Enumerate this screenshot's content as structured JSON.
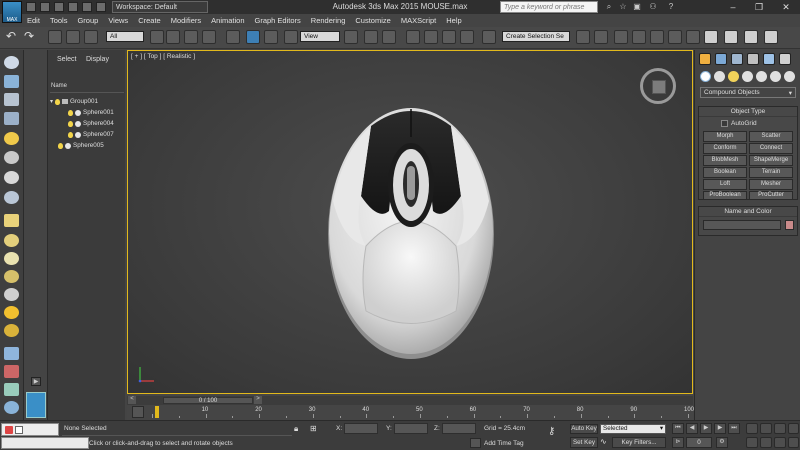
{
  "app": {
    "logo_text": "MAX",
    "workspace": "Workspace: Default",
    "window_title": "Autodesk 3ds Max  2015     MOUSE.max",
    "search_placeholder": "Type a keyword or phrase"
  },
  "menu": [
    "Edit",
    "Tools",
    "Group",
    "Views",
    "Create",
    "Modifiers",
    "Animation",
    "Graph Editors",
    "Rendering",
    "Customize",
    "MAXScript",
    "Help"
  ],
  "toolbar": {
    "filter_select": "All",
    "coord_system": "View",
    "selection_set": "Create Selection Se"
  },
  "explorer": {
    "tab_select": "Select",
    "tab_display": "Display",
    "column_name": "Name",
    "items": [
      {
        "label": "Group001",
        "depth": 0,
        "kind": "group"
      },
      {
        "label": "Sphere001",
        "depth": 1,
        "kind": "sphere"
      },
      {
        "label": "Sphere004",
        "depth": 1,
        "kind": "sphere"
      },
      {
        "label": "Sphere007",
        "depth": 1,
        "kind": "sphere"
      },
      {
        "label": "Sphere005",
        "depth": 0,
        "kind": "sphere"
      }
    ]
  },
  "viewport": {
    "label": "[ + ] [ Top ] [ Realistic ]",
    "border_color": "#e2b91c",
    "viewcube_face": "TOP"
  },
  "command_panel": {
    "category_dropdown": "Compound Objects",
    "object_type_title": "Object Type",
    "autogrid_label": "AutoGrid",
    "buttons": [
      "Morph",
      "Scatter",
      "Conform",
      "Connect",
      "BlobMesh",
      "ShapeMerge",
      "Boolean",
      "Terrain",
      "Loft",
      "Mesher",
      "ProBoolean",
      "ProCutter"
    ],
    "name_color_title": "Name and Color",
    "swatch_color": "#c98a8a"
  },
  "timeline": {
    "time_label": "0 / 100",
    "ticks": [
      "0",
      "10",
      "20",
      "30",
      "40",
      "50",
      "60",
      "70",
      "80",
      "90",
      "100"
    ]
  },
  "status": {
    "selection": "None Selected",
    "prompt": "Click or click-and-drag to select and rotate objects",
    "x_label": "X:",
    "y_label": "Y:",
    "z_label": "Z:",
    "grid": "Grid = 25.4cm",
    "add_time_tag": "Add Time Tag",
    "auto_key": "Auto Key",
    "set_key": "Set Key",
    "selected_dropdown": "Selected",
    "key_filters": "Key Filters...",
    "current_frame": "0"
  }
}
